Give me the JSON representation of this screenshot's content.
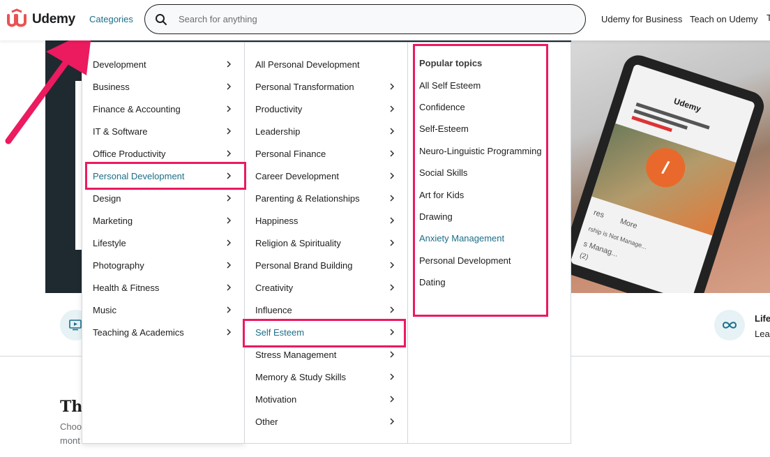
{
  "header": {
    "logo_text": "Udemy",
    "categories_label": "Categories",
    "search_placeholder": "Search for anything",
    "business_label": "Udemy for Business",
    "teach_label": "Teach on Udemy",
    "cut_label": "T"
  },
  "colors": {
    "brand": "#a435f0",
    "logo_red": "#ea5252",
    "link_teal": "#1c6e8a",
    "highlight": "#ec1a5f"
  },
  "menu": {
    "categories": [
      {
        "label": "Development"
      },
      {
        "label": "Business"
      },
      {
        "label": "Finance & Accounting"
      },
      {
        "label": "IT & Software"
      },
      {
        "label": "Office Productivity"
      },
      {
        "label": "Personal Development",
        "active": true
      },
      {
        "label": "Design"
      },
      {
        "label": "Marketing"
      },
      {
        "label": "Lifestyle"
      },
      {
        "label": "Photography"
      },
      {
        "label": "Health & Fitness"
      },
      {
        "label": "Music"
      },
      {
        "label": "Teaching & Academics"
      }
    ],
    "subcategories": [
      {
        "label": "All Personal Development",
        "has_children": false
      },
      {
        "label": "Personal Transformation",
        "has_children": true
      },
      {
        "label": "Productivity",
        "has_children": true
      },
      {
        "label": "Leadership",
        "has_children": true
      },
      {
        "label": "Personal Finance",
        "has_children": true
      },
      {
        "label": "Career Development",
        "has_children": true
      },
      {
        "label": "Parenting & Relationships",
        "has_children": true
      },
      {
        "label": "Happiness",
        "has_children": true
      },
      {
        "label": "Religion & Spirituality",
        "has_children": true
      },
      {
        "label": "Personal Brand Building",
        "has_children": true
      },
      {
        "label": "Creativity",
        "has_children": true
      },
      {
        "label": "Influence",
        "has_children": true
      },
      {
        "label": "Self Esteem",
        "has_children": true,
        "active": true
      },
      {
        "label": "Stress Management",
        "has_children": true
      },
      {
        "label": "Memory & Study Skills",
        "has_children": true
      },
      {
        "label": "Motivation",
        "has_children": true
      },
      {
        "label": "Other",
        "has_children": true
      }
    ],
    "popular_heading": "Popular topics",
    "popular_topics": [
      {
        "label": "All Self Esteem"
      },
      {
        "label": "Confidence"
      },
      {
        "label": "Self-Esteem"
      },
      {
        "label": "Neuro-Linguistic Programming"
      },
      {
        "label": "Social Skills"
      },
      {
        "label": "Art for Kids"
      },
      {
        "label": "Drawing"
      },
      {
        "label": "Anxiety Management",
        "accent": true
      },
      {
        "label": "Personal Development"
      },
      {
        "label": "Dating"
      }
    ]
  },
  "background": {
    "band_right_title": "Life",
    "band_right_sub": "Lea",
    "section_title": "The",
    "section_sub1": "Choo",
    "section_sub2": "mont",
    "phone": {
      "logo": "Udemy",
      "tab1": "res",
      "tab2": "More",
      "item1": "rship is Not Manage...",
      "item2": "s Manag...",
      "item3": "(2)"
    }
  }
}
